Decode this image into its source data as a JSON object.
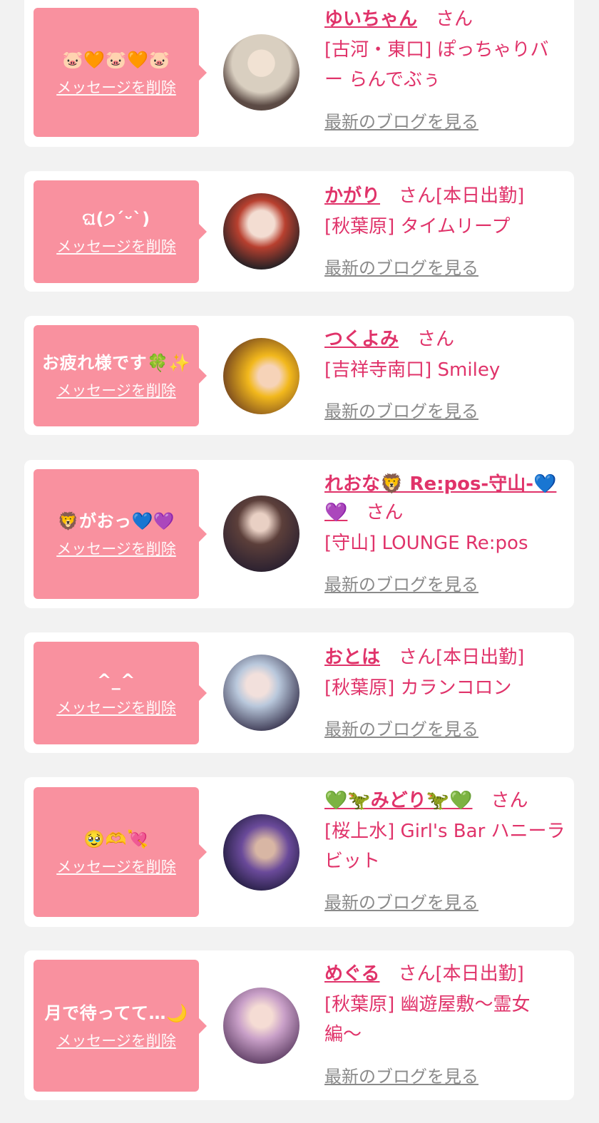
{
  "theme": {
    "accent": "#e0336a",
    "bubble": "#f9919f",
    "card": "#ffffff",
    "background": "#f2f2f2",
    "link_gray": "#8a8a8a"
  },
  "labels": {
    "delete": "メッセージを削除",
    "blog": "最新のブログを見る",
    "san": "さん"
  },
  "entries": [
    {
      "message": "🐷🧡🐷🧡🐷",
      "name": "ゆいちゃん",
      "suffix": "さん",
      "shop": "[古河・東口] ぽっちゃりバー らんでぶぅ",
      "avatar_icon": "user-avatar",
      "avatar_colors": [
        "#d9cfc0",
        "#5b4a44"
      ]
    },
    {
      "message": "ଘ(੭ˊᵕˋ)",
      "name": "かがり",
      "suffix": "さん[本日出勤]",
      "shop": "[秋葉原] タイムリープ",
      "avatar_icon": "user-avatar",
      "avatar_colors": [
        "#b8402f",
        "#2a2225"
      ]
    },
    {
      "message": "お疲れ様です🍀✨",
      "name": "つくよみ",
      "suffix": "さん",
      "shop": "[吉祥寺南口] Smiley",
      "avatar_icon": "user-avatar",
      "avatar_colors": [
        "#f2b81c",
        "#7a4a1e"
      ]
    },
    {
      "message": "🦁がおっ💙💜",
      "name": "れおな🦁 Re:pos-守山-💙💜",
      "suffix": "さん",
      "shop": "[守山] LOUNGE Re:pos",
      "avatar_icon": "user-avatar",
      "avatar_colors": [
        "#5c3f3a",
        "#2a2030"
      ]
    },
    {
      "message": "^_^",
      "name": "おとは",
      "suffix": "さん[本日出勤]",
      "shop": "[秋葉原] カランコロン",
      "avatar_icon": "user-avatar",
      "avatar_colors": [
        "#b9c8dc",
        "#3a3650"
      ]
    },
    {
      "message": "🥹🫶💘",
      "name": "💚🦖みどり🦖💚",
      "suffix": "さん",
      "shop": "[桜上水] Girl's Bar ハニーラビット",
      "avatar_icon": "user-avatar",
      "avatar_colors": [
        "#6a4a9a",
        "#1e1a3a"
      ]
    },
    {
      "message": "月で待ってて…🌙",
      "name": "めぐる",
      "suffix": "さん[本日出勤]",
      "shop": "[秋葉原] 幽遊屋敷〜霊女編〜",
      "avatar_icon": "user-avatar",
      "avatar_colors": [
        "#c9a0c8",
        "#5a3a60"
      ]
    }
  ]
}
